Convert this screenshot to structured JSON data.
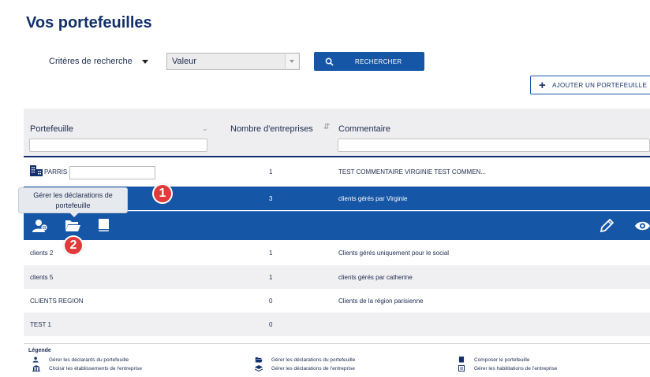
{
  "page": {
    "title": "Vos portefeuilles"
  },
  "search": {
    "criteria_label": "Critères de recherche",
    "value_label": "Valeur",
    "button_label": "RECHERCHER"
  },
  "add_button_label": "AJOUTER UN PORTEFEUILLE",
  "table": {
    "columns": [
      "Portefeuille",
      "Nombre d'entreprises",
      "Commentaire"
    ],
    "rows": [
      {
        "name": "PARRIS",
        "count": "1",
        "comment": "TEST COMMENTAIRE VIRGINIE TEST COMMEN..."
      },
      {
        "name": "",
        "count": "3",
        "comment": "clients gérés par Virginie"
      },
      {
        "name": "clients 2",
        "count": "1",
        "comment": "Clients gérés uniquement pour le social"
      },
      {
        "name": "clients 5",
        "count": "1",
        "comment": "clients gérés par catherine"
      },
      {
        "name": "CLIENTS REGION",
        "count": "0",
        "comment": "Clients de la région parisienne"
      },
      {
        "name": "TEST 1",
        "count": "0",
        "comment": ""
      }
    ]
  },
  "tooltip": {
    "line1": "Gérer les déclarations de",
    "line2": "portefeuille"
  },
  "badges": [
    "1",
    "2"
  ],
  "legend": {
    "title": "Légende",
    "items": [
      {
        "icon": "user-manage-icon",
        "label": "Gérer les déclarants du portefeuille"
      },
      {
        "icon": "bank-icon",
        "label": "Choisir les établissements de l'entreprise"
      },
      {
        "icon": "folder-icon",
        "label": "Gérer les déclarations du portefeuille"
      },
      {
        "icon": "layers-icon",
        "label": "Gérer les déclarations de l'entreprise"
      },
      {
        "icon": "book-icon",
        "label": "Composer le portefeuille"
      },
      {
        "icon": "list-icon",
        "label": "Gérer les habilitations de l'entreprise"
      }
    ]
  },
  "colors": {
    "primary": "#1656a6",
    "title": "#12306b",
    "badge": "#e03b3b"
  }
}
